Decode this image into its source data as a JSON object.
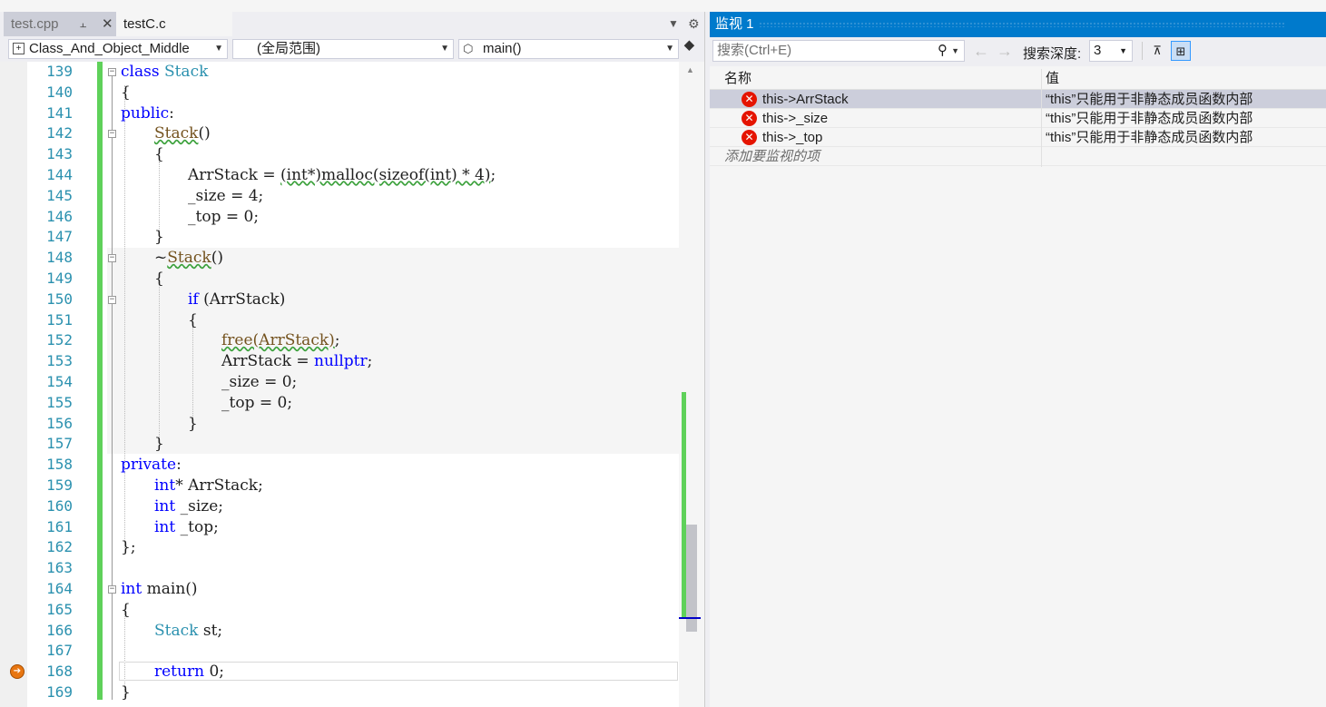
{
  "tabs": [
    {
      "label": "test.cpp",
      "active": false
    },
    {
      "label": "testC.c",
      "active": true
    }
  ],
  "navbar": {
    "project": "Class_And_Object_Middle",
    "scope": "(全局范围)",
    "member": "main()"
  },
  "code": {
    "lines": [
      {
        "n": "139"
      },
      {
        "n": "140"
      },
      {
        "n": "141"
      },
      {
        "n": "142"
      },
      {
        "n": "143"
      },
      {
        "n": "144"
      },
      {
        "n": "145"
      },
      {
        "n": "146"
      },
      {
        "n": "147"
      },
      {
        "n": "148"
      },
      {
        "n": "149"
      },
      {
        "n": "150"
      },
      {
        "n": "151"
      },
      {
        "n": "152"
      },
      {
        "n": "153"
      },
      {
        "n": "154"
      },
      {
        "n": "155"
      },
      {
        "n": "156"
      },
      {
        "n": "157"
      },
      {
        "n": "158"
      },
      {
        "n": "159"
      },
      {
        "n": "160"
      },
      {
        "n": "161"
      },
      {
        "n": "162"
      },
      {
        "n": "163"
      },
      {
        "n": "164"
      },
      {
        "n": "165"
      },
      {
        "n": "166"
      },
      {
        "n": "167"
      },
      {
        "n": "168"
      },
      {
        "n": "169"
      }
    ],
    "t": {
      "l139a": "class",
      "l139b": " Stack",
      "l140": "{",
      "l141a": "public",
      "l141b": ":",
      "l142a": "Stack",
      "l142b": "()",
      "l143": "{",
      "l144a": "ArrStack = ",
      "l144b": "(int*)malloc(sizeof(int) * 4)",
      "l144c": ";",
      "l145": "_size = 4;",
      "l146": "_top = 0;",
      "l147": "}",
      "l148a": "~",
      "l148b": "Stack",
      "l148c": "()",
      "l149": "{",
      "l150a": "if",
      "l150b": " (ArrStack)",
      "l151": "{",
      "l152a": "free(ArrStack)",
      "l152b": ";",
      "l153a": "ArrStack = ",
      "l153b": "nullptr",
      "l153c": ";",
      "l154": "_size = 0;",
      "l155": "_top = 0;",
      "l156": "}",
      "l157": "}",
      "l158a": "private",
      "l158b": ":",
      "l159a": "int",
      "l159b": "* ArrStack;",
      "l160a": "int",
      "l160b": " _size;",
      "l161a": "int",
      "l161b": " _top;",
      "l162": "};",
      "l163": "",
      "l164a": "int",
      "l164b": " main()",
      "l165": "{",
      "l166a": "Stack",
      "l166b": " st;",
      "l167": "",
      "l168a": "return",
      "l168b": " 0;",
      "l169": "}"
    }
  },
  "watch": {
    "title": "监视 1",
    "search_placeholder": "搜索(Ctrl+E)",
    "depth_label": "搜索深度:",
    "depth_value": "3",
    "col_name": "名称",
    "col_value": "值",
    "rows": [
      {
        "name": "this->ArrStack",
        "value": "“this”只能用于非静态成员函数内部"
      },
      {
        "name": "this->_size",
        "value": "“this”只能用于非静态成员函数内部"
      },
      {
        "name": "this->_top",
        "value": "“this”只能用于非静态成员函数内部"
      }
    ],
    "add_item": "添加要监视的项"
  },
  "icons": {
    "pin": "pin-icon",
    "close": "close-icon",
    "search": "search-icon",
    "error": "error-icon",
    "breakpoint": "current-statement-arrow-icon"
  },
  "colors": {
    "accent": "#007acc",
    "keyword": "#0000ff",
    "type": "#2b91af",
    "change_bar": "#5fd15a",
    "error": "#e51400",
    "current_line_marker": "#e87611"
  }
}
